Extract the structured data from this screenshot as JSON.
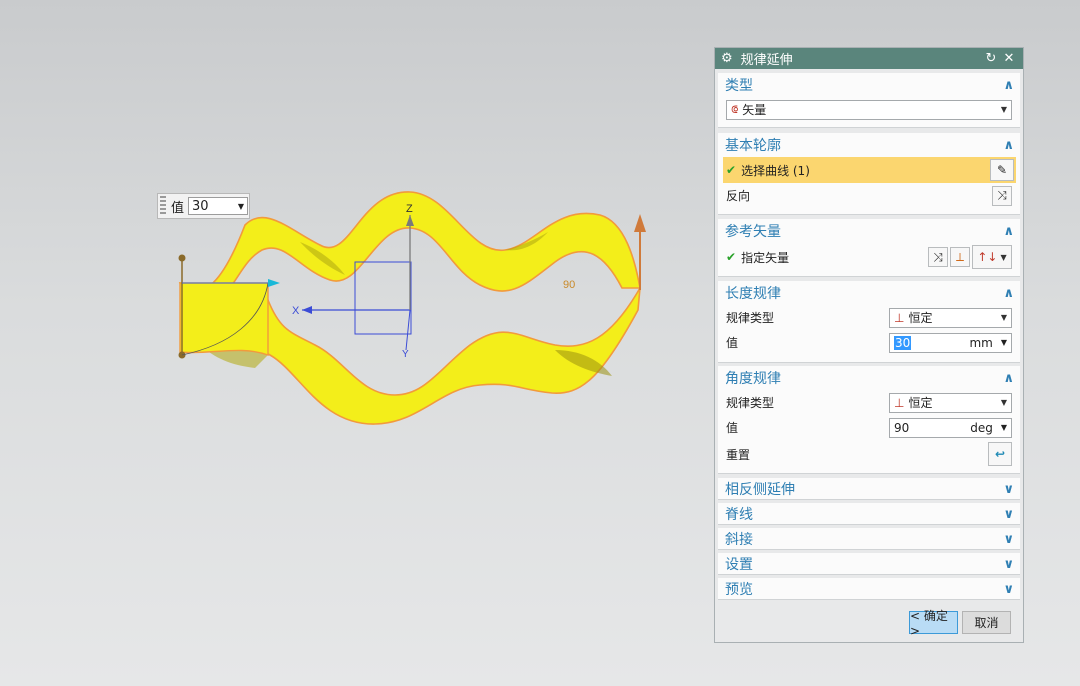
{
  "viewport": {
    "value_label": "值",
    "value": "30",
    "axis_labels": {
      "x": "X",
      "y": "Y",
      "z": "Z"
    },
    "angle_label": "90",
    "surface_color": "#f5f000",
    "edge_color": "#f29a3c"
  },
  "dialog": {
    "title": "规律延伸",
    "type_section": {
      "title": "类型",
      "selected": "矢量"
    },
    "base_profile": {
      "title": "基本轮廓",
      "select_curve": "选择曲线 (1)",
      "reverse": "反向"
    },
    "ref_vector": {
      "title": "参考矢量",
      "specify_vector": "指定矢量"
    },
    "length_law": {
      "title": "长度规律",
      "law_type_label": "规律类型",
      "law_type_value": "恒定",
      "value_label": "值",
      "value": "30",
      "unit": "mm"
    },
    "angle_law": {
      "title": "角度规律",
      "law_type_label": "规律类型",
      "law_type_value": "恒定",
      "value_label": "值",
      "value": "90",
      "unit": "deg",
      "reset_label": "重置"
    },
    "collapsed_sections": [
      "相反侧延伸",
      "脊线",
      "斜接",
      "设置",
      "预览"
    ],
    "ok_button": "< 确定 >",
    "cancel_button": "取消",
    "accent_color": "#2f7fb3",
    "titlebar_color": "#5a857c",
    "highlight_color": "#fbd66f"
  }
}
